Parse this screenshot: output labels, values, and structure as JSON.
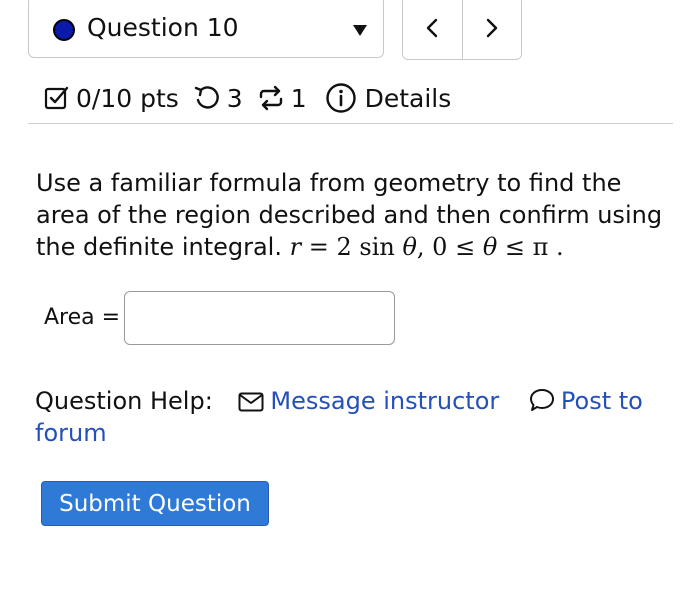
{
  "question_selector": {
    "label": "Question 10",
    "status_color": "#0b1aa8"
  },
  "nav": {
    "prev_icon": "chevron-left-icon",
    "next_icon": "chevron-right-icon"
  },
  "meta": {
    "points": "0/10 pts",
    "attempts": "3",
    "retries": "1",
    "details_label": "Details"
  },
  "prompt": {
    "text": "Use a familiar formula from geometry to find the area of the region described and then confirm using the definite integral.",
    "math_r": "r",
    "math_eq": " = 2 sin ",
    "math_theta1": "θ",
    "math_range": ", 0 ≤ ",
    "math_theta2": "θ",
    "math_le_pi": " ≤ π",
    "math_end": " ."
  },
  "answer": {
    "label": "Area =",
    "value": "",
    "placeholder": ""
  },
  "help": {
    "label": "Question Help:",
    "message_label": "Message instructor",
    "post_label": "Post to forum"
  },
  "submit": {
    "label": "Submit Question"
  },
  "colors": {
    "link": "#2550b8",
    "submit_bg": "#2f7ad6"
  }
}
